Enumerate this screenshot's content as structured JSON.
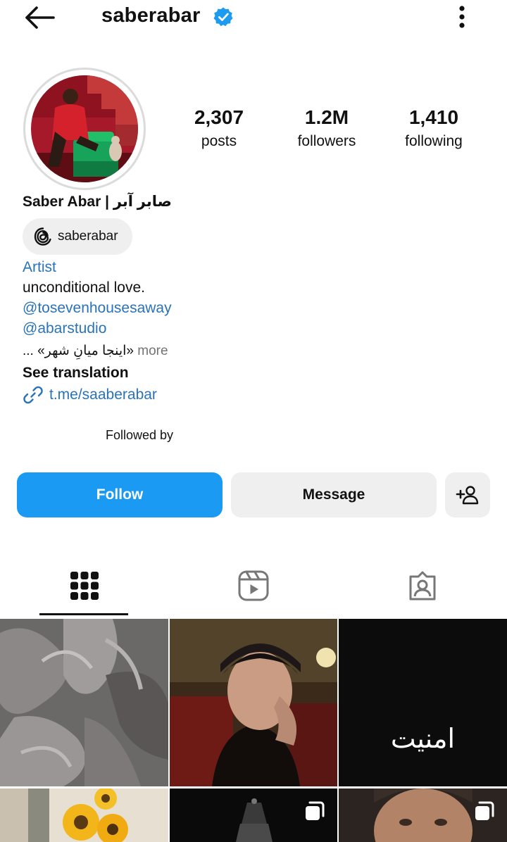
{
  "header": {
    "username": "saberabar",
    "verified": true
  },
  "stats": [
    {
      "value": "2,307",
      "label": "posts"
    },
    {
      "value": "1.2M",
      "label": "followers"
    },
    {
      "value": "1,410",
      "label": "following"
    }
  ],
  "profile": {
    "full_name": "Saber Abar | صابر آبر",
    "threads_handle": "saberabar",
    "category": "Artist",
    "bio_line1": "unconditional love.",
    "mention1": "@tosevenhousesaway",
    "mention2": "@abarstudio",
    "bio_rtl": "«اینجا میانِ شهر» ...",
    "more_label": "more",
    "see_translation": "See translation",
    "link": "t.me/saaberabar",
    "followed_by": "Followed by"
  },
  "actions": {
    "follow_label": "Follow",
    "message_label": "Message"
  },
  "tabs": [
    {
      "icon": "grid-icon",
      "active": true
    },
    {
      "icon": "reels-icon",
      "active": false
    },
    {
      "icon": "tagged-icon",
      "active": false
    }
  ],
  "grid": [
    {
      "caption": "",
      "multi": false
    },
    {
      "caption": "",
      "multi": false
    },
    {
      "caption": "امنیت",
      "multi": false
    },
    {
      "caption": "",
      "multi": false
    },
    {
      "caption": "",
      "multi": true
    },
    {
      "caption": "",
      "multi": true
    }
  ],
  "colors": {
    "accent": "#1a9af2",
    "link": "#2a73b8",
    "verified": "#1d9bf0",
    "button_bg": "#efefef"
  }
}
